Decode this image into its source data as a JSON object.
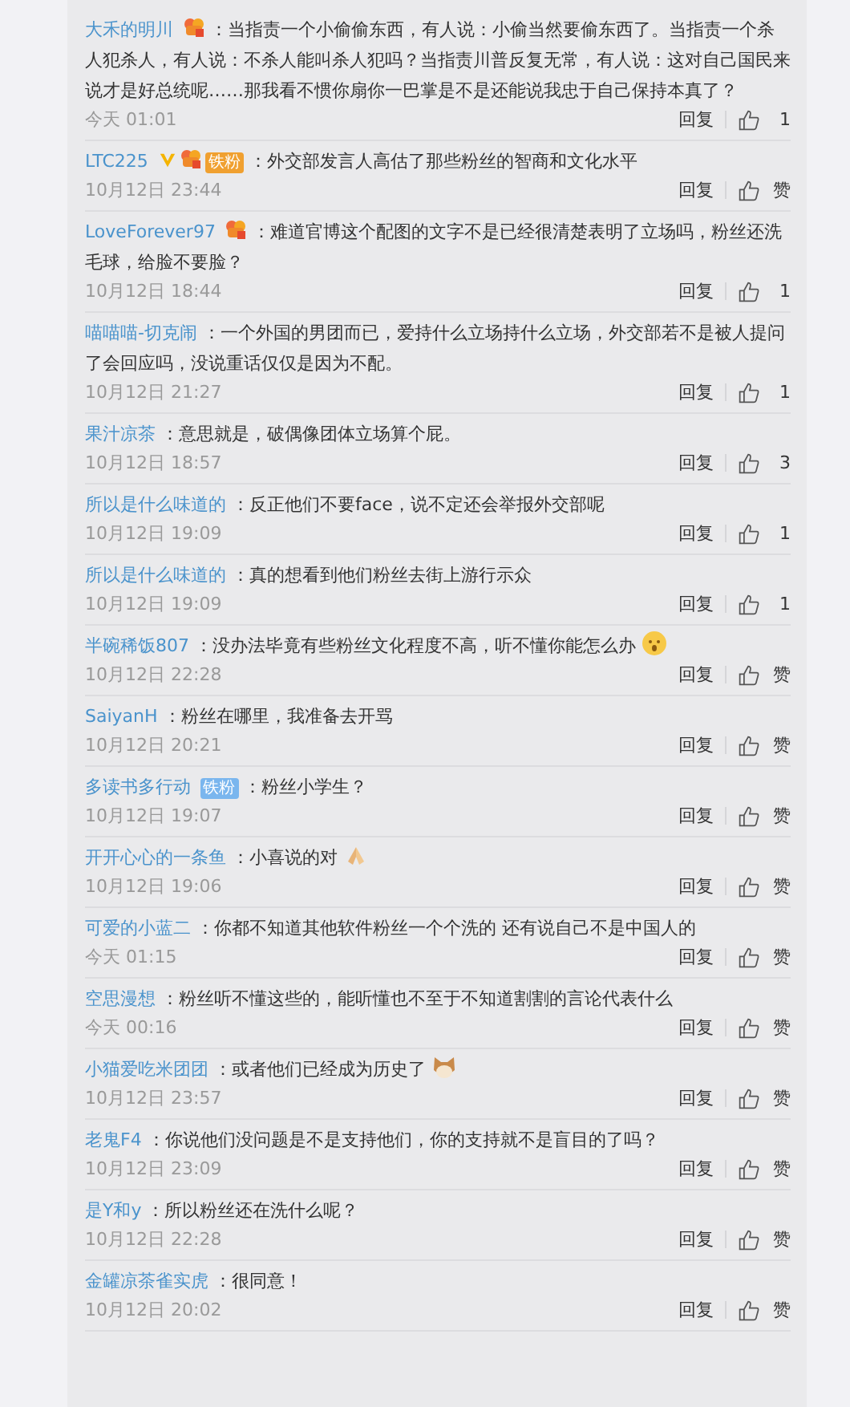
{
  "comments": [
    {
      "user": "大禾的明川",
      "badges": [
        {
          "kind": "level"
        }
      ],
      "text": "：当指责一个小偷偷东西，有人说：小偷当然要偷东西了。当指责一个杀人犯杀人，有人说：不杀人能叫杀人犯吗？当指责川普反复无常，有人说：这对自己国民来说才是好总统呢……那我看不惯你扇你一巴掌是不是还能说我忠于自己保持本真了？",
      "time": "今天 01:01",
      "reply": "回复",
      "like": "1"
    },
    {
      "user": "LTC225",
      "badges": [
        {
          "kind": "verified"
        },
        {
          "kind": "level"
        },
        {
          "kind": "fan",
          "text": "铁粉",
          "color": "#f0a030"
        }
      ],
      "text": "：外交部发言人高估了那些粉丝的智商和文化水平",
      "time": "10月12日 23:44",
      "reply": "回复",
      "like": "赞"
    },
    {
      "user": "LoveForever97",
      "badges": [
        {
          "kind": "level"
        }
      ],
      "text": "：难道官博这个配图的文字不是已经很清楚表明了立场吗，粉丝还洗毛球，给脸不要脸？",
      "time": "10月12日 18:44",
      "reply": "回复",
      "like": "1"
    },
    {
      "user": "喵喵喵-切克闹",
      "text": "：一个外国的男团而已，爱持什么立场持什么立场，外交部若不是被人提问了会回应吗，没说重话仅仅是因为不配。",
      "time": "10月12日 21:27",
      "reply": "回复",
      "like": "1"
    },
    {
      "user": "果汁凉茶",
      "text": "：意思就是，破偶像团体立场算个屁。",
      "time": "10月12日 18:57",
      "reply": "回复",
      "like": "3"
    },
    {
      "user": "所以是什么味道的",
      "text": "：反正他们不要face，说不定还会举报外交部呢",
      "time": "10月12日 19:09",
      "reply": "回复",
      "like": "1"
    },
    {
      "user": "所以是什么味道的",
      "text": "：真的想看到他们粉丝去街上游行示众",
      "time": "10月12日 19:09",
      "reply": "回复",
      "like": "1"
    },
    {
      "user": "半碗稀饭807",
      "text": "：没办法毕竟有些粉丝文化程度不高，听不懂你能怎么办",
      "sticker": {
        "kind": "face"
      },
      "time": "10月12日 22:28",
      "reply": "回复",
      "like": "赞"
    },
    {
      "user": "SaiyanH",
      "text": "：粉丝在哪里，我准备去开骂",
      "time": "10月12日 20:21",
      "reply": "回复",
      "like": "赞"
    },
    {
      "user": "多读书多行动",
      "badges": [
        {
          "kind": "fan",
          "text": "铁粉",
          "color": "#7ab6ee"
        }
      ],
      "text": "：粉丝小学生？",
      "time": "10月12日 19:07",
      "reply": "回复",
      "like": "赞"
    },
    {
      "user": "开开心心的一条鱼",
      "text": "：小喜说的对",
      "sticker": {
        "kind": "hands"
      },
      "time": "10月12日 19:06",
      "reply": "回复",
      "like": "赞"
    },
    {
      "user": "可爱的小蓝二",
      "text": "：你都不知道其他软件粉丝一个个洗的 还有说自己不是中国人的",
      "time": "今天 01:15",
      "reply": "回复",
      "like": "赞"
    },
    {
      "user": "空思漫想",
      "text": "：粉丝听不懂这些的，能听懂也不至于不知道割割的言论代表什么",
      "time": "今天 00:16",
      "reply": "回复",
      "like": "赞"
    },
    {
      "user": "小猫爱吃米团团",
      "text": "：或者他们已经成为历史了",
      "sticker": {
        "kind": "cat"
      },
      "time": "10月12日 23:57",
      "reply": "回复",
      "like": "赞"
    },
    {
      "user": "老鬼F4",
      "text": "：你说他们没问题是不是支持他们，你的支持就不是盲目的了吗？",
      "time": "10月12日 23:09",
      "reply": "回复",
      "like": "赞"
    },
    {
      "user": "是Y和y",
      "text": "：所以粉丝还在洗什么呢？",
      "time": "10月12日 22:28",
      "reply": "回复",
      "like": "赞"
    },
    {
      "user": "金罐凉茶雀实虎",
      "text": "：很同意！",
      "time": "10月12日 20:02",
      "reply": "回复",
      "like": "赞"
    }
  ]
}
